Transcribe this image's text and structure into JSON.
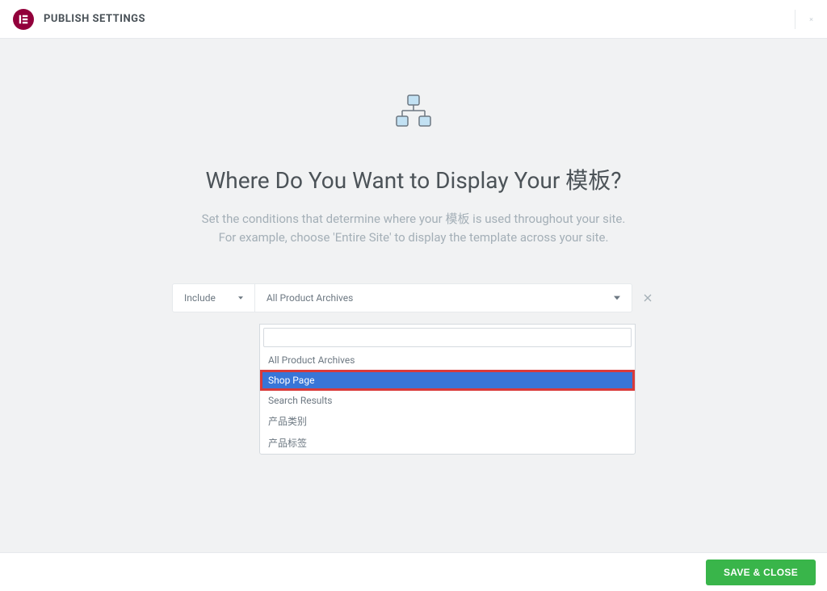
{
  "header": {
    "title": "PUBLISH SETTINGS"
  },
  "icon_names": {
    "logo": "elementor-logo-icon",
    "close": "close-icon",
    "sitemap": "sitemap-icon",
    "caret": "caret-down-icon",
    "remove": "remove-icon"
  },
  "main": {
    "heading": "Where Do You Want to Display Your 模板?",
    "subtext_line1": "Set the conditions that determine where your 模板 is used throughout your site.",
    "subtext_line2": "For example, choose 'Entire Site' to display the template across your site."
  },
  "condition": {
    "include_label": "Include",
    "archive_label": "All Product Archives"
  },
  "dropdown": {
    "search_value": "",
    "options": [
      {
        "label": "All Product Archives",
        "highlighted": false
      },
      {
        "label": "Shop Page",
        "highlighted": true
      },
      {
        "label": "Search Results",
        "highlighted": false
      },
      {
        "label": "产品类别",
        "highlighted": false
      },
      {
        "label": "产品标签",
        "highlighted": false
      }
    ]
  },
  "footer": {
    "save_label": "SAVE & CLOSE"
  }
}
